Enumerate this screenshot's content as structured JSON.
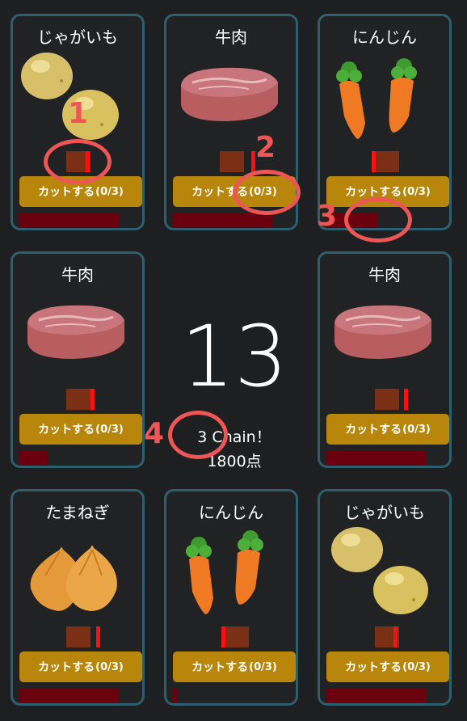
{
  "center": {
    "score": "13",
    "chain": "3 Chain！",
    "points": "1800点"
  },
  "cards": [
    {
      "name": "じゃがいも",
      "food": "potato",
      "button_label": "カットする",
      "button_count": "(0/3)"
    },
    {
      "name": "牛肉",
      "food": "beef",
      "button_label": "カットする",
      "button_count": "(0/3)"
    },
    {
      "name": "にんじん",
      "food": "carrot",
      "button_label": "カットする",
      "button_count": "(0/3)"
    },
    {
      "name": "牛肉",
      "food": "beef",
      "button_label": "カットする",
      "button_count": "(0/3)"
    },
    {
      "name": "牛肉",
      "food": "beef",
      "button_label": "カットする",
      "button_count": "(0/3)"
    },
    {
      "name": "たまねぎ",
      "food": "onion",
      "button_label": "カットする",
      "button_count": "(0/3)"
    },
    {
      "name": "にんじん",
      "food": "carrot",
      "button_label": "カットする",
      "button_count": "(0/3)"
    },
    {
      "name": "じゃがいも",
      "food": "potato",
      "button_label": "カットする",
      "button_count": "(0/3)"
    }
  ],
  "annotations": [
    "1",
    "2",
    "3",
    "4"
  ],
  "colors": {
    "card_border": "#2e5f6f",
    "button": "#b8860b",
    "gauge_block": "#7b2f14",
    "gauge_marker": "#ff1010",
    "hp_bar": "#6a000d",
    "annotation": "#ee5555"
  }
}
